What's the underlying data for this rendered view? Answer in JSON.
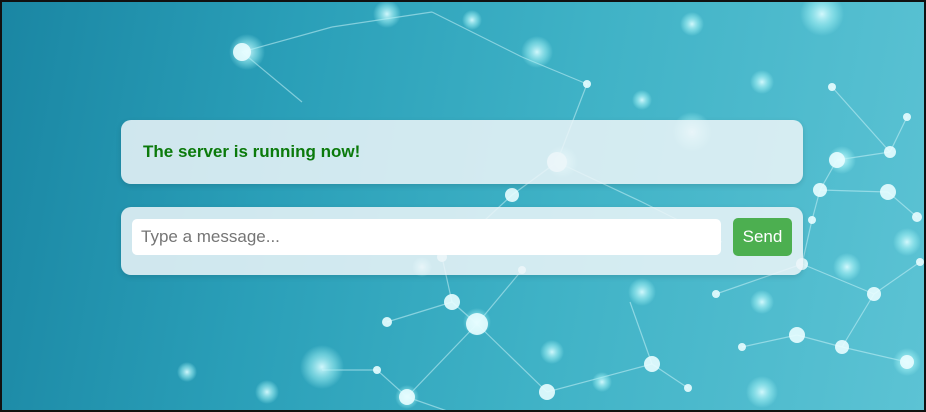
{
  "status": {
    "message": "The server is running now!",
    "color": "#0b7a0b"
  },
  "composer": {
    "input_value": "",
    "input_placeholder": "Type a message...",
    "send_label": "Send",
    "send_color": "#4caf50"
  },
  "background": {
    "description_icon": "network-graph",
    "colors": [
      "#1a86a3",
      "#5cc3d4"
    ]
  }
}
